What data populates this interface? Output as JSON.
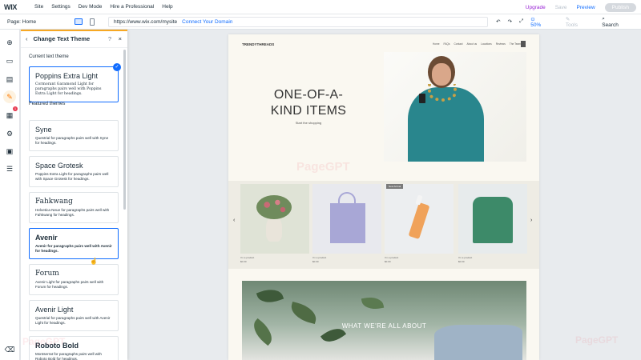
{
  "topbar": {
    "logo": "WIX",
    "menu": [
      "Site",
      "Settings",
      "Dev Mode",
      "Hire a Professional",
      "Help"
    ],
    "upgrade": "Upgrade",
    "save": "Save",
    "preview": "Preview",
    "publish": "Publish"
  },
  "subbar": {
    "page": "Page: Home",
    "url": "https://www.wix.com/mysite",
    "connect": "Connect Your Domain",
    "zoom": "50%",
    "tools": "Tools",
    "search": "Search"
  },
  "panel": {
    "title": "Change Text Theme",
    "current_label": "Current text theme",
    "current": {
      "title": "Poppins Extra Light",
      "desc": "Cormorant Garamond Light for paragraphs pairs well with Poppins Extra Light for headings."
    },
    "featured_label": "Featured themes",
    "themes": [
      {
        "title": "Syne",
        "desc": "Questrial for paragraphs pairs well with Syne for headings."
      },
      {
        "title": "Space Grotesk",
        "desc": "Poppins Extra Light for paragraphs pairs well with Space Grotesk for headings."
      },
      {
        "title": "Fahkwang",
        "desc": "Helvetica Neue for paragraphs pairs well with Fahkwang for headings."
      },
      {
        "title": "Avenir",
        "desc": "Avenir for paragraphs pairs well with Avenir for headings."
      },
      {
        "title": "Forum",
        "desc": "Avenir Light for paragraphs pairs well with Forum for headings."
      },
      {
        "title": "Avenir Light",
        "desc": "Questrial for paragraphs pairs well with Avenir Light for headings."
      },
      {
        "title": "Roboto Bold",
        "desc": "Montserrat for paragraphs pairs well with Roboto Bold for headings."
      }
    ]
  },
  "site": {
    "logo": "TRENDYTHREADS",
    "nav": [
      "Home",
      "FAQs",
      "Contact",
      "About us",
      "Locations",
      "Reviews",
      "The Team"
    ],
    "hero_line1": "ONE-OF-A-",
    "hero_line2": "KIND ITEMS",
    "hero_sub": "Start the shopping",
    "new_tag": "New Arrival",
    "products": [
      {
        "name": "I'm a product",
        "price": "$0.00"
      },
      {
        "name": "I'm a product",
        "price": "$0.00"
      },
      {
        "name": "I'm a product",
        "price": "$0.00"
      },
      {
        "name": "I'm a product",
        "price": "$0.00"
      }
    ],
    "about_title": "WHAT WE'RE ALL ABOUT"
  },
  "colors": {
    "accent": "#116dff",
    "upgrade": "#9a27d5",
    "panel_accent": "#f7a823",
    "canvas_bg": "#faf8f1"
  },
  "watermark": "PageGPT"
}
